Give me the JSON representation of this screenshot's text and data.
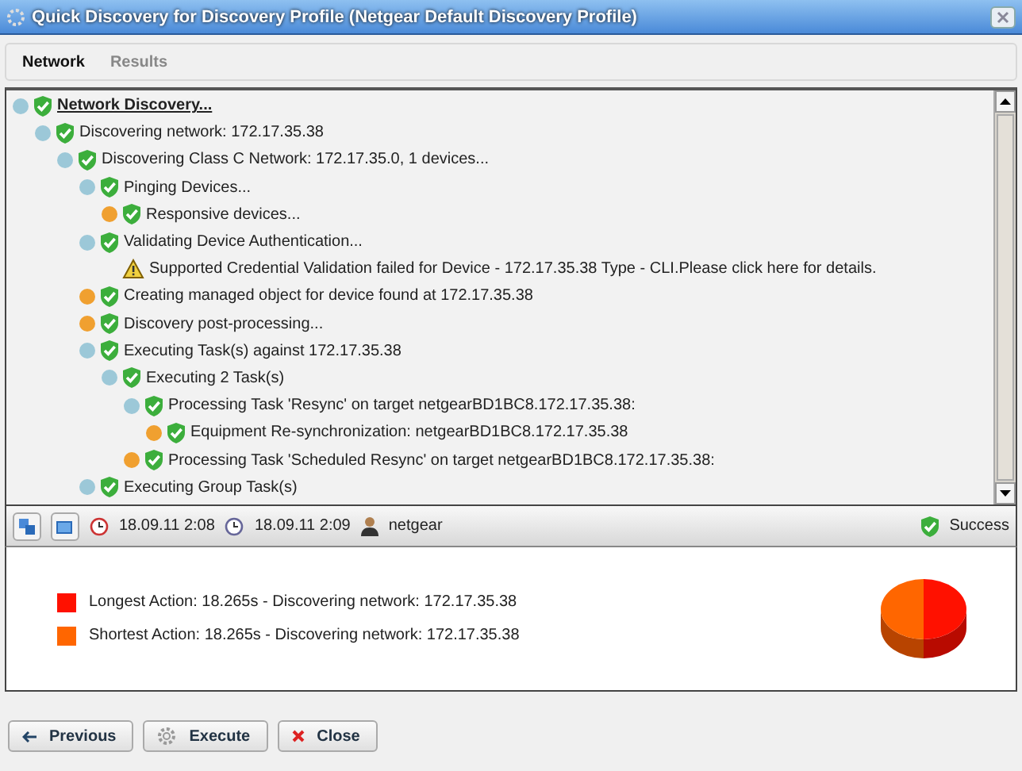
{
  "window": {
    "title": "Quick Discovery for Discovery Profile (Netgear Default Discovery Profile)"
  },
  "tabs": [
    {
      "label": "Network",
      "selected": true
    },
    {
      "label": "Results",
      "selected": false
    }
  ],
  "tree": [
    {
      "text": "Network Discovery...",
      "kind": "success",
      "expanded": true,
      "children": [
        {
          "text": "Discovering network: 172.17.35.38",
          "kind": "success",
          "expanded": true,
          "children": [
            {
              "text": "Discovering Class C Network: 172.17.35.0, 1 devices...",
              "kind": "success",
              "expanded": true,
              "children": [
                {
                  "text": "Pinging Devices...",
                  "kind": "success",
                  "expanded": true,
                  "children": [
                    {
                      "text": "Responsive devices...",
                      "kind": "success",
                      "expanded": false
                    }
                  ]
                },
                {
                  "text": "Validating Device Authentication...",
                  "kind": "success",
                  "expanded": true,
                  "children": [
                    {
                      "text": "Supported Credential Validation failed for Device - 172.17.35.38 Type - CLI.Please click here for details.",
                      "kind": "warning"
                    }
                  ]
                },
                {
                  "text": "Creating managed object for device found at 172.17.35.38",
                  "kind": "success",
                  "expanded": false
                },
                {
                  "text": "Discovery post-processing...",
                  "kind": "success",
                  "expanded": false
                },
                {
                  "text": "Executing Task(s) against 172.17.35.38",
                  "kind": "success",
                  "expanded": true,
                  "children": [
                    {
                      "text": "Executing 2 Task(s)",
                      "kind": "success",
                      "expanded": true,
                      "children": [
                        {
                          "text": "Processing Task 'Resync' on target netgearBD1BC8.172.17.35.38:",
                          "kind": "success",
                          "expanded": true,
                          "children": [
                            {
                              "text": "Equipment Re-synchronization: netgearBD1BC8.172.17.35.38",
                              "kind": "success",
                              "expanded": false
                            }
                          ]
                        },
                        {
                          "text": "Processing Task 'Scheduled Resync' on target netgearBD1BC8.172.17.35.38:",
                          "kind": "success",
                          "expanded": false
                        }
                      ]
                    }
                  ]
                },
                {
                  "text": "Executing Group Task(s)",
                  "kind": "success",
                  "expanded": true
                }
              ]
            }
          ]
        }
      ]
    }
  ],
  "status": {
    "start": "18.09.11 2:08",
    "end": "18.09.11 2:09",
    "user": "netgear",
    "result": "Success"
  },
  "legend": [
    {
      "text": "Longest Action: 18.265s - Discovering network: 172.17.35.38",
      "color": "#ff1100"
    },
    {
      "text": "Shortest Action: 18.265s - Discovering network: 172.17.35.38",
      "color": "#ff6600"
    }
  ],
  "buttons": [
    {
      "label": "Previous",
      "kind": "back"
    },
    {
      "label": "Execute",
      "kind": "gear"
    },
    {
      "label": "Close",
      "kind": "close"
    }
  ]
}
